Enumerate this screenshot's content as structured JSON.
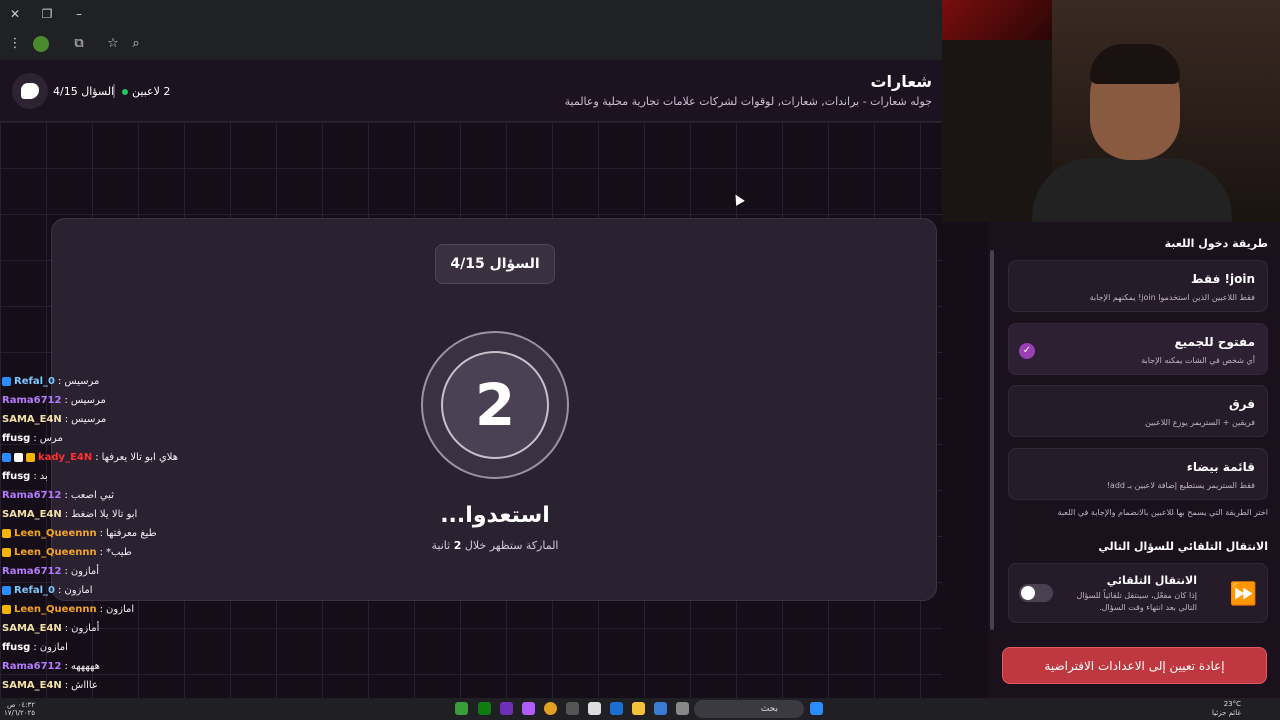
{
  "header": {
    "title": "شعارات",
    "subtitle": "جوله شعارات - براندات, شعارات, لوقوات لشركات علامات تجارية محلية وعالمية",
    "players": "2 لاعبين",
    "question": "السؤال 4/15"
  },
  "card": {
    "question_pill": "السؤال 4/15",
    "countdown": "2",
    "ready": "استعدوا...",
    "ready_sub_pre": "الماركة ستظهر خلال",
    "ready_sub_num": "2",
    "ready_sub_post": "ثانية"
  },
  "chat": [
    {
      "user": "Refal_0",
      "msg": "مرسيس",
      "color": "#7ec8ff",
      "badges": [
        "#2b8cff"
      ]
    },
    {
      "user": "Rama6712",
      "msg": "مرسيس",
      "color": "#b57cff",
      "badges": []
    },
    {
      "user": "SAMA_E4N",
      "msg": "مرسيس",
      "color": "#f1e1a6",
      "badges": []
    },
    {
      "user": "ffusg",
      "msg": "مرس",
      "color": "#ffffff",
      "badges": []
    },
    {
      "user": "kady_E4N",
      "msg": "هلاي ابو تالا يعرفها",
      "color": "#ff3030",
      "badges": [
        "#2b8cff",
        "#ffffff",
        "#f5b400"
      ]
    },
    {
      "user": "ffusg",
      "msg": "بد",
      "color": "#ffffff",
      "badges": []
    },
    {
      "user": "Rama6712",
      "msg": "ثبي اصعب",
      "color": "#b57cff",
      "badges": []
    },
    {
      "user": "SAMA_E4N",
      "msg": "ابو تالا يلا اضغط",
      "color": "#f1e1a6",
      "badges": []
    },
    {
      "user": "Leen_Queennn",
      "msg": "طيغ معرفتها",
      "color": "#f5a524",
      "badges": [
        "#f5b400"
      ]
    },
    {
      "user": "Leen_Queennn",
      "msg": "*طيب",
      "color": "#f5a524",
      "badges": [
        "#f5b400"
      ]
    },
    {
      "user": "Rama6712",
      "msg": "أمازون",
      "color": "#b57cff",
      "badges": []
    },
    {
      "user": "Refal_0",
      "msg": "امازون",
      "color": "#7ec8ff",
      "badges": [
        "#2b8cff"
      ]
    },
    {
      "user": "Leen_Queennn",
      "msg": "امازون",
      "color": "#f5a524",
      "badges": [
        "#f5b400"
      ]
    },
    {
      "user": "SAMA_E4N",
      "msg": "أمازون",
      "color": "#f1e1a6",
      "badges": []
    },
    {
      "user": "ffusg",
      "msg": "امازون",
      "color": "#ffffff",
      "badges": []
    },
    {
      "user": "Rama6712",
      "msg": "هههههه",
      "color": "#b57cff",
      "badges": []
    },
    {
      "user": "SAMA_E4N",
      "msg": "عاااش",
      "color": "#f1e1a6",
      "badges": []
    }
  ],
  "panel": {
    "join_title": "طريقة دخول اللعبة",
    "options": [
      {
        "title": "join! فقط",
        "desc": "فقط اللاعبين الذين استخدموا join! يمكنهم الإجابة",
        "active": false
      },
      {
        "title": "مفتوح للجميع",
        "desc": "أي شخص في الشات يمكنه الإجابة",
        "active": true
      },
      {
        "title": "فرق",
        "desc": "فريقين + الستريمر يوزع اللاعبين",
        "active": false
      },
      {
        "title": "قائمة بيضاء",
        "desc": "فقط الستريمر يستطيع إضافة لاعبين بـ add!",
        "active": false
      }
    ],
    "hint": "اختر الطريقة التي يسمح بها للاعبين بالانضمام والإجابة في اللعبة",
    "auto_section": "الانتقال التلقائي للسؤال التالي",
    "auto_title": "الانتقال التلقائي",
    "auto_desc": "إذا كان مفعّل، سينتقل تلقائياً للسؤال التالي بعد انتهاء وقت السؤال.",
    "auto_enabled": false,
    "reset": "إعادة تعيين إلى الاعدادات الافتراضية"
  },
  "taskbar": {
    "search": "بحث",
    "time": "٠٤:٣٢ ص",
    "date": "١٧/٦/٢٠٢٥",
    "temp": "23°C",
    "weather": "غائم جزئيا"
  }
}
